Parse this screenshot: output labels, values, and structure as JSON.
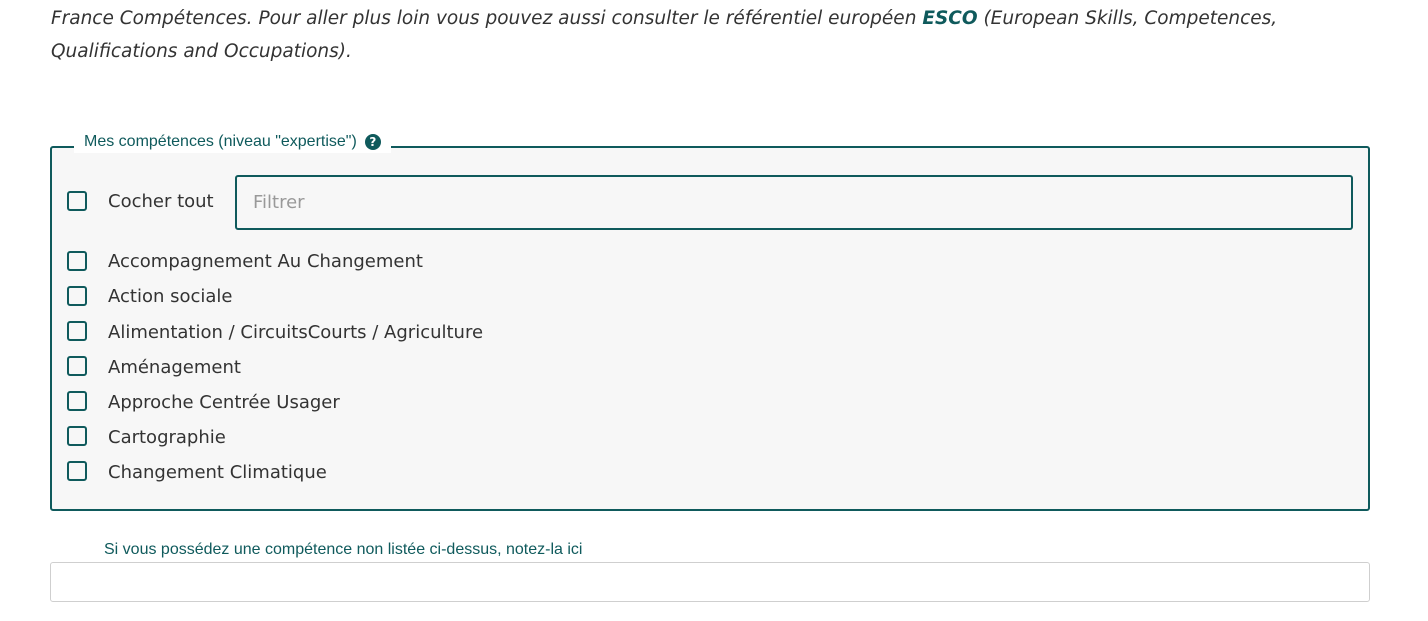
{
  "intro": {
    "text_before": "France Compétences. Pour aller plus loin vous pouvez aussi consulter le référentiel européen ",
    "link": "ESCO",
    "text_after": " (European Skills, Competences, Qualifications and Occupations)."
  },
  "skills": {
    "legend": "Mes compétences (niveau \"expertise\")",
    "help_icon": "question-circle-icon",
    "check_all_label": "Cocher tout",
    "filter_placeholder": "Filtrer",
    "items": [
      {
        "label": "Accompagnement Au Changement",
        "checked": false
      },
      {
        "label": "Action sociale",
        "checked": false
      },
      {
        "label": "Alimentation / CircuitsCourts / Agriculture",
        "checked": false
      },
      {
        "label": "Aménagement",
        "checked": false
      },
      {
        "label": "Approche Centrée Usager",
        "checked": false
      },
      {
        "label": "Cartographie",
        "checked": false
      },
      {
        "label": "Changement Climatique",
        "checked": false
      }
    ]
  },
  "other_skill": {
    "label": "Si vous possédez une compétence non listée ci-dessus, notez-la ici",
    "value": ""
  },
  "colors": {
    "accent": "#0f5a5c",
    "panel_bg": "#f7f7f7",
    "text": "#333333"
  }
}
